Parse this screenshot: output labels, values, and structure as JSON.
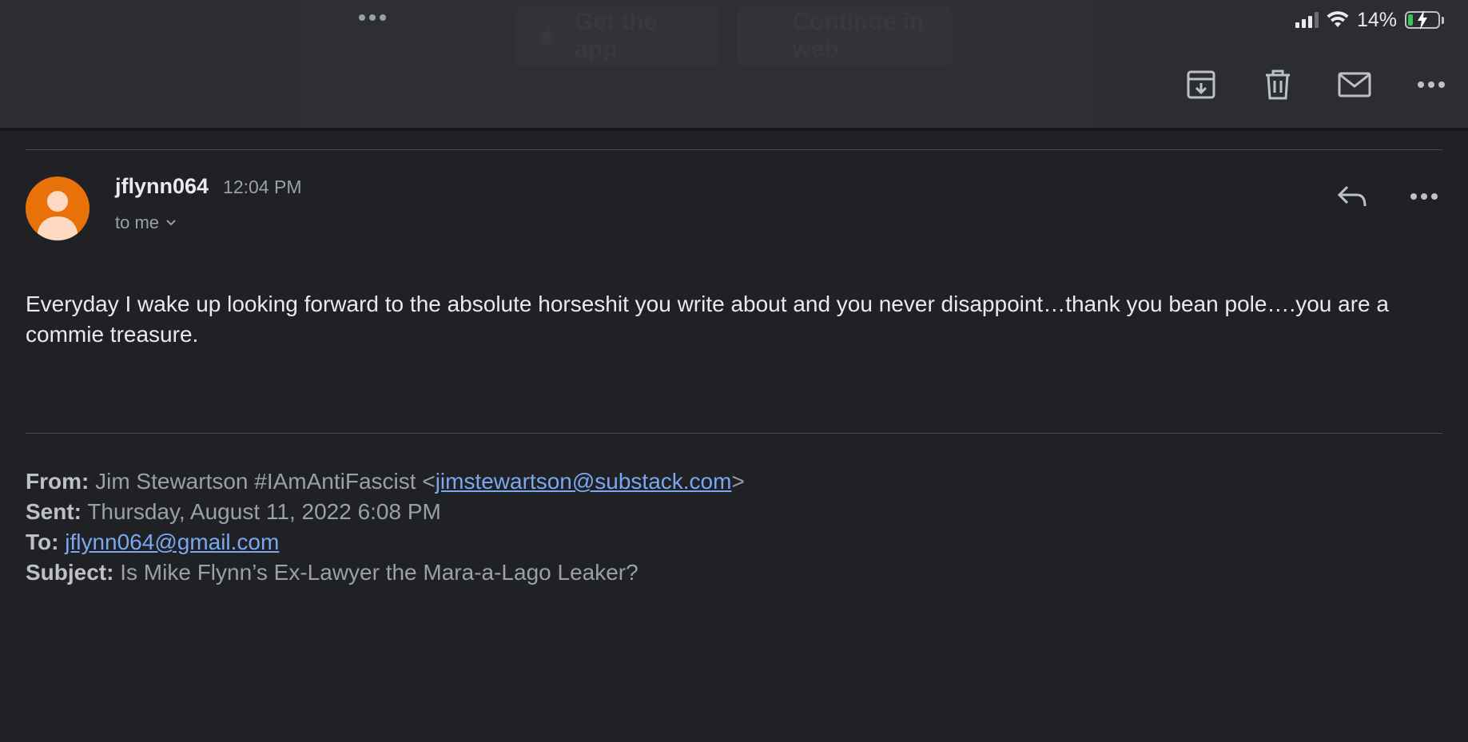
{
  "status_bar": {
    "battery_text": "14%",
    "battery_level": 0.14,
    "icons": [
      "signal-icon",
      "wifi-icon",
      "battery-charging-icon"
    ]
  },
  "top_bar": {
    "multitask_icon": "ellipsis-icon",
    "get_app_label": "Get the app",
    "web_label": "Continue in web",
    "actions": [
      "archive-icon",
      "trash-icon",
      "mark-unread-icon",
      "more-icon"
    ]
  },
  "message": {
    "sender": "jflynn064",
    "time": "12:04 PM",
    "recipient": "to me",
    "body": "Everyday I wake up looking forward to the absolute horseshit you write about and you never disappoint…thank you bean pole….you are a commie treasure."
  },
  "quoted_header": {
    "from_label": "From:",
    "from_name": "Jim Stewartson #IAmAntiFascist <",
    "from_email": "jimstewartson@substack.com",
    "from_close": ">",
    "sent_label": "Sent:",
    "sent_value": "Thursday, August 11, 2022 6:08 PM",
    "to_label": "To:",
    "to_email": "jflynn064@gmail.com",
    "subject_label": "Subject:",
    "subject_value": "Is Mike Flynn’s Ex-Lawyer the Mara-a-Lago Leaker?"
  },
  "colors": {
    "background": "#202124",
    "avatar": "#e8710a",
    "link": "#7aa7f0",
    "battery": "#34c759"
  }
}
